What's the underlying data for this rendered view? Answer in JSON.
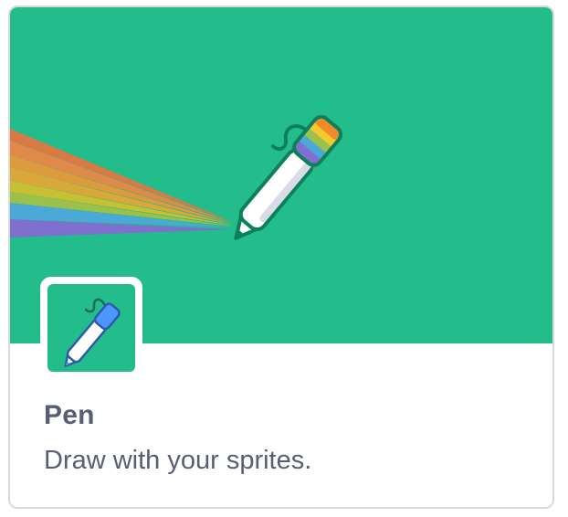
{
  "extension": {
    "name": "Pen",
    "description": "Draw with your sprites."
  },
  "icons": {
    "banner": "rainbow-pen-icon",
    "tile": "blue-pen-icon"
  },
  "colors": {
    "banner_bg": "#22bd8a",
    "text": "#575e75",
    "card_border": "#d9d9d9",
    "pen_cap_blue": "#4c97ff"
  }
}
